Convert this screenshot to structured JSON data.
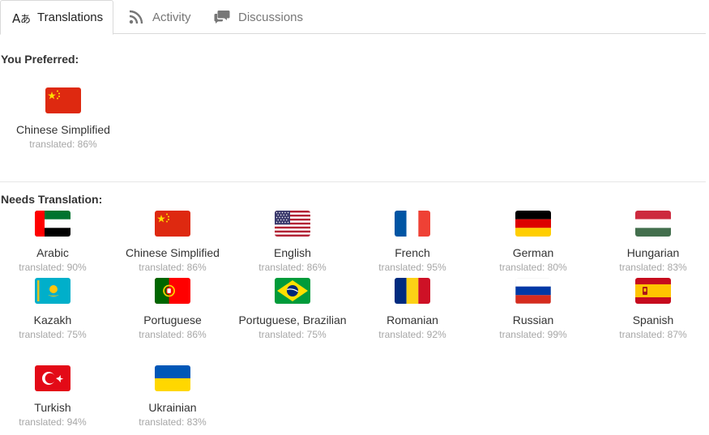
{
  "tabs": [
    {
      "label": "Translations",
      "icon": "translate-icon",
      "active": true
    },
    {
      "label": "Activity",
      "icon": "rss-feed-icon",
      "active": false
    },
    {
      "label": "Discussions",
      "icon": "chat-bubbles-icon",
      "active": false
    }
  ],
  "preferred": {
    "title": "You Preferred:",
    "items": [
      {
        "name": "Chinese Simplified",
        "pct": "translated: 86%",
        "flag": "china-flag-icon"
      }
    ]
  },
  "needs": {
    "title": "Needs Translation:",
    "items": [
      {
        "name": "Arabic",
        "pct": "translated: 90%",
        "flag": "uae-flag-icon"
      },
      {
        "name": "Chinese Simplified",
        "pct": "translated: 86%",
        "flag": "china-flag-icon"
      },
      {
        "name": "English",
        "pct": "translated: 86%",
        "flag": "usa-flag-icon"
      },
      {
        "name": "French",
        "pct": "translated: 95%",
        "flag": "france-flag-icon"
      },
      {
        "name": "German",
        "pct": "translated: 80%",
        "flag": "germany-flag-icon"
      },
      {
        "name": "Hungarian",
        "pct": "translated: 83%",
        "flag": "hungary-flag-icon"
      },
      {
        "name": "Kazakh",
        "pct": "translated: 75%",
        "flag": "kazakhstan-flag-icon"
      },
      {
        "name": "Portuguese",
        "pct": "translated: 86%",
        "flag": "portugal-flag-icon"
      },
      {
        "name": "Portuguese, Brazilian",
        "pct": "translated: 75%",
        "flag": "brazil-flag-icon"
      },
      {
        "name": "Romanian",
        "pct": "translated: 92%",
        "flag": "romania-flag-icon"
      },
      {
        "name": "Russian",
        "pct": "translated: 99%",
        "flag": "russia-flag-icon"
      },
      {
        "name": "Spanish",
        "pct": "translated: 87%",
        "flag": "spain-flag-icon"
      },
      {
        "name": "Turkish",
        "pct": "translated: 94%",
        "flag": "turkey-flag-icon"
      },
      {
        "name": "Ukrainian",
        "pct": "translated: 83%",
        "flag": "ukraine-flag-icon"
      }
    ]
  }
}
